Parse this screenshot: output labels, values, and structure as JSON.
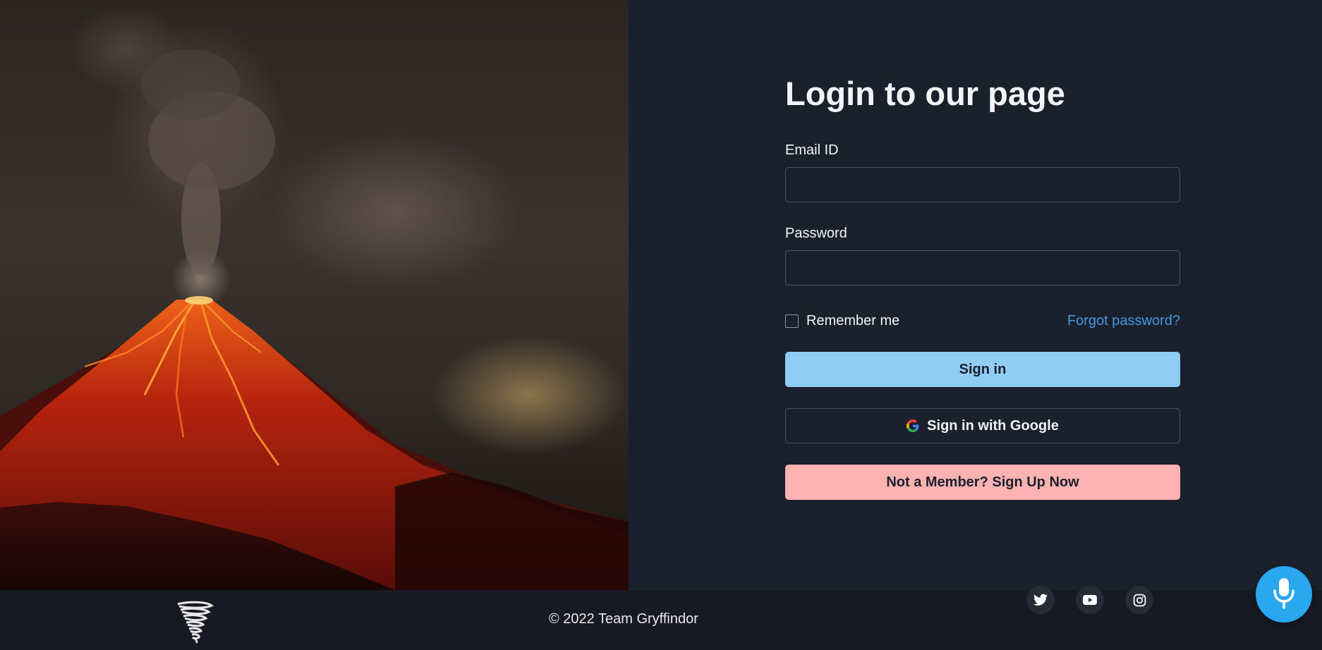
{
  "login": {
    "title": "Login to our page",
    "email_label": "Email ID",
    "email_value": "",
    "password_label": "Password",
    "password_value": "",
    "remember_label": "Remember me",
    "remember_checked": false,
    "forgot_label": "Forgot password?",
    "signin_label": "Sign in",
    "google_label": "Sign in with Google",
    "signup_label": "Not a Member? Sign Up Now"
  },
  "footer": {
    "copyright": "© 2022 Team Gryffindor",
    "logo_icon": "tornado-icon",
    "social": [
      {
        "name": "twitter-icon"
      },
      {
        "name": "youtube-icon"
      },
      {
        "name": "instagram-icon"
      }
    ]
  },
  "fab": {
    "icon": "microphone-icon"
  },
  "hero": {
    "icon": "volcano-image"
  },
  "colors": {
    "background": "#1a202c",
    "footer": "#171923",
    "signin_button": "#90cdf4",
    "signup_button": "#feb2b2",
    "link": "#4399e6",
    "mic_button": "#29a8f0"
  }
}
